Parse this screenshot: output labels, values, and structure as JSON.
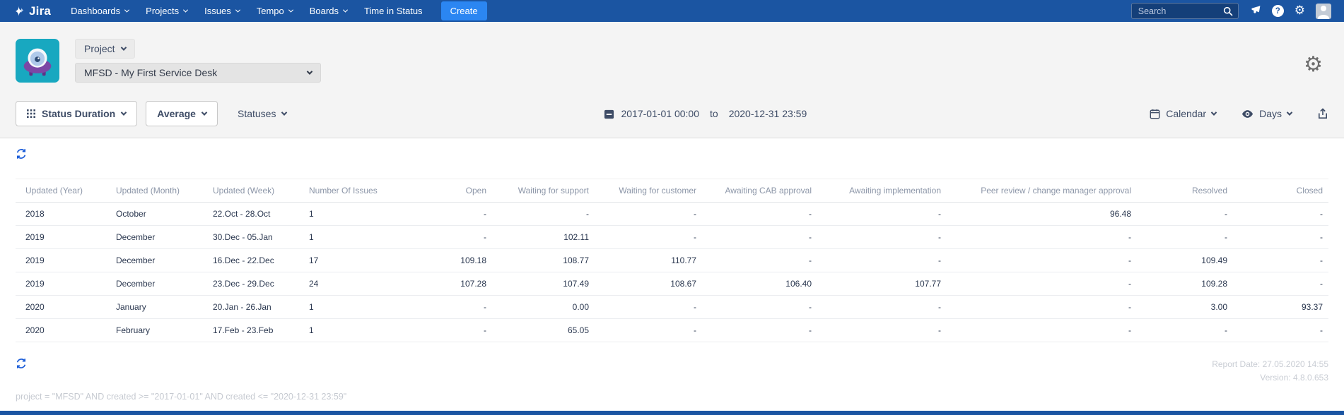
{
  "colors": {
    "nav-blue": "#1B55A2",
    "create-blue": "#2B86F2",
    "teal": "#18A8C0",
    "purple": "#7C47A5",
    "link-blue": "#1A5CD8",
    "header-gray": "#F4F4F4",
    "text-toolbar": "#3E4C66",
    "text-muted": "#8C96A8",
    "text-dark": "#2B3850"
  },
  "nav": {
    "brand": "Jira",
    "items": [
      {
        "label": "Dashboards",
        "chevron": true
      },
      {
        "label": "Projects",
        "chevron": true
      },
      {
        "label": "Issues",
        "chevron": true
      },
      {
        "label": "Tempo",
        "chevron": true
      },
      {
        "label": "Boards",
        "chevron": true
      },
      {
        "label": "Time in Status",
        "chevron": false
      }
    ],
    "create_label": "Create",
    "search_placeholder": "Search"
  },
  "header": {
    "project_button_label": "Project",
    "project_select_value": "MFSD - My First Service Desk"
  },
  "toolbar": {
    "report_type_label": "Status Duration",
    "aggregation_label": "Average",
    "statuses_label": "Statuses",
    "date_from": "2017-01-01 00:00",
    "date_separator": "to",
    "date_to": "2020-12-31 23:59",
    "calendar_label": "Calendar",
    "unit_label": "Days"
  },
  "table": {
    "columns": [
      "Updated (Year)",
      "Updated (Month)",
      "Updated (Week)",
      "Number Of Issues",
      "Open",
      "Waiting for support",
      "Waiting for customer",
      "Awaiting CAB approval",
      "Awaiting implementation",
      "Peer review / change manager approval",
      "Resolved",
      "Closed"
    ],
    "rows": [
      [
        "2018",
        "October",
        "22.Oct - 28.Oct",
        "1",
        "-",
        "-",
        "-",
        "-",
        "-",
        "96.48",
        "-",
        "-"
      ],
      [
        "2019",
        "December",
        "30.Dec - 05.Jan",
        "1",
        "-",
        "102.11",
        "-",
        "-",
        "-",
        "-",
        "-",
        "-"
      ],
      [
        "2019",
        "December",
        "16.Dec - 22.Dec",
        "17",
        "109.18",
        "108.77",
        "110.77",
        "-",
        "-",
        "-",
        "109.49",
        "-"
      ],
      [
        "2019",
        "December",
        "23.Dec - 29.Dec",
        "24",
        "107.28",
        "107.49",
        "108.67",
        "106.40",
        "107.77",
        "-",
        "109.28",
        "-"
      ],
      [
        "2020",
        "January",
        "20.Jan - 26.Jan",
        "1",
        "-",
        "0.00",
        "-",
        "-",
        "-",
        "-",
        "3.00",
        "93.37"
      ],
      [
        "2020",
        "February",
        "17.Feb - 23.Feb",
        "1",
        "-",
        "65.05",
        "-",
        "-",
        "-",
        "-",
        "-",
        "-"
      ]
    ]
  },
  "footer": {
    "report_date": "Report Date: 27.05.2020 14:55",
    "version": "Version: 4.8.0.653",
    "query": "project = \"MFSD\" AND created >= \"2017-01-01\" AND created <= \"2020-12-31 23:59\""
  }
}
